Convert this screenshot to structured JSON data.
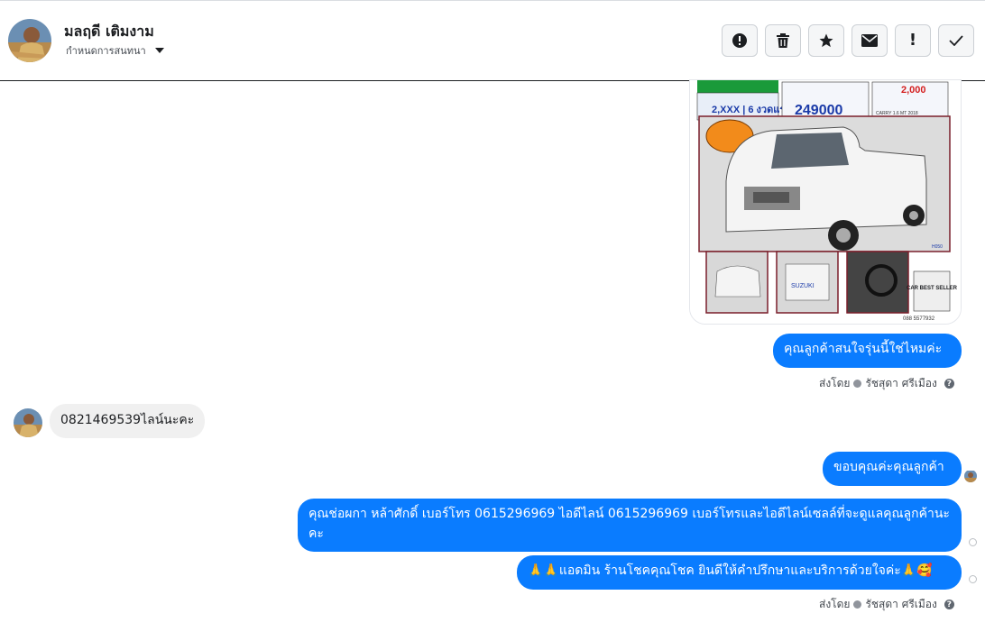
{
  "header": {
    "name": "มลฤดี เติมงาม",
    "assign_label": "กำหนดการสนทนา",
    "actions": [
      "spam",
      "delete",
      "star",
      "mark-unread",
      "follow-up",
      "done"
    ]
  },
  "car_ad": {
    "price": "249000",
    "down": "2,XXX | 6 งวดแรก",
    "monthly": "2,000",
    "model": "CARRY 1.6 MT 2018",
    "badge": "CAR BEST SELLER",
    "phone": "088 5577932",
    "brand": "SUZUKI",
    "code": "H050"
  },
  "messages": {
    "m1": "คุณลูกค้าสนใจรุ่นนี้ใช่ไหมค่ะ",
    "sent_by_1": {
      "prefix": "ส่งโดย",
      "agent": "รัชสุดา ศรีเมือง"
    },
    "m2": "0821469539ไลน์นะคะ",
    "m3": "ขอบคุณค่ะคุณลูกค้า",
    "m4": "คุณช่อผกา หล้าศักดิ์ เบอร์โทร 0615296969 ไอดีไลน์ 0615296969 เบอร์โทรและไอดีไลน์เซลล์ที่จะดูแลคุณลูกค้านะคะ",
    "m5": "🙏🙏แอดมิน ร้านโชคคุณโชค ยินดีให้คำปรึกษาและบริการด้วยใจค่ะ🙏🥰",
    "sent_by_2": {
      "prefix": "ส่งโดย",
      "agent": "รัชสุดา ศรีเมือง"
    }
  },
  "colors": {
    "accent": "#0a7cff",
    "incoming": "#f0f0f0"
  }
}
